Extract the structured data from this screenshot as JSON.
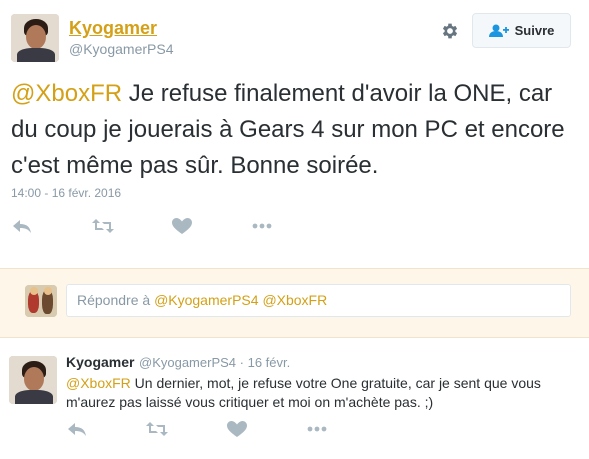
{
  "tweet": {
    "author_name": "Kyogamer",
    "author_handle": "@KyogamerPS4",
    "follow_label": "Suivre",
    "mention": "@XboxFR",
    "text": " Je refuse finalement d'avoir la ONE, car du coup je jouerais à Gears 4 sur mon PC et encore c'est même pas sûr. Bonne soirée.",
    "timestamp": "14:00 - 16 févr. 2016"
  },
  "reply_box": {
    "prefix": "Répondre à ",
    "mention1": "@KyogamerPS4",
    "mention2": "@XboxFR"
  },
  "reply": {
    "author_name": "Kyogamer",
    "author_handle": "@KyogamerPS4",
    "separator": " · ",
    "date": "16 févr.",
    "mention": "@XboxFR",
    "text": " Un dernier, mot, je refuse votre One gratuite, car je sent que vous m'aurez pas laissé vous critiquer et moi on m'achète pas. ;)"
  },
  "icons": {
    "settings": "gear-icon",
    "follow": "add-user-icon",
    "reply": "reply-icon",
    "retweet": "retweet-icon",
    "like": "heart-icon",
    "more": "more-icon"
  },
  "colors": {
    "link": "#d4a017",
    "muted": "#8899a6",
    "text": "#292f33",
    "reply_bg": "#fdf6e9"
  }
}
